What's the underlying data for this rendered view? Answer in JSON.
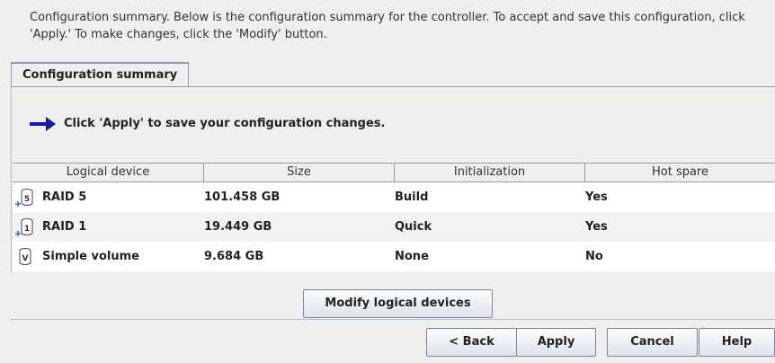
{
  "intro": "Configuration summary. Below is the configuration summary for the controller.  To accept and save this configuration, click 'Apply.'  To make changes, click the 'Modify' button.",
  "tab_label": "Configuration summary",
  "message": "Click 'Apply' to save your configuration changes.",
  "table": {
    "headers": [
      "Logical device",
      "Size",
      "Initialization",
      "Hot spare"
    ],
    "rows": [
      {
        "device": "RAID 5",
        "icon": "raid-5-icon",
        "icon_glyph": "5",
        "size": "101.458 GB",
        "init": "Build",
        "hotspare": "Yes"
      },
      {
        "device": "RAID 1",
        "icon": "raid-1-icon",
        "icon_glyph": "1",
        "size": "19.449 GB",
        "init": "Quick",
        "hotspare": "Yes"
      },
      {
        "device": "Simple volume",
        "icon": "simple-volume-icon",
        "icon_glyph": "V",
        "size": "9.684 GB",
        "init": "None",
        "hotspare": "No"
      }
    ]
  },
  "buttons": {
    "modify": "Modify logical devices",
    "back": "< Back",
    "apply": "Apply",
    "cancel": "Cancel",
    "help": "Help"
  },
  "colors": {
    "arrow": "#1a1a9e",
    "tab_border": "#8a9bb5",
    "plus": "#3a6fd0"
  }
}
